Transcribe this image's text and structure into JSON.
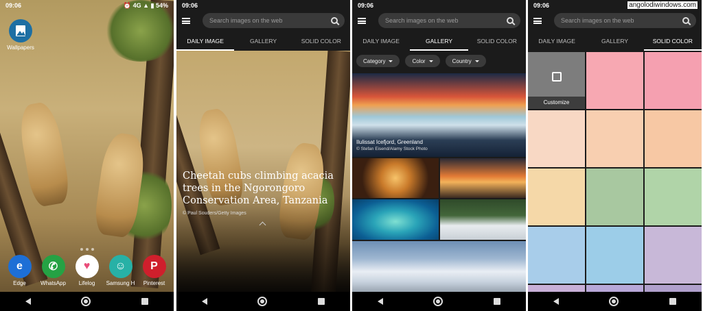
{
  "status_time": "09:06",
  "home": {
    "status_right": "⏰ 4G ▲ ▮ 54%",
    "top_app": "Wallpapers",
    "dock": [
      {
        "label": "Edge",
        "color": "#1d6fd6"
      },
      {
        "label": "WhatsApp",
        "color": "#25a244"
      },
      {
        "label": "Lifelog",
        "color": "#f2a0b6"
      },
      {
        "label": "Samsung H",
        "color": "#27b1a6"
      },
      {
        "label": "Pinterest",
        "color": "#cf1f2c"
      }
    ]
  },
  "search_placeholder": "Search images on the web",
  "tabs": [
    "DAILY IMAGE",
    "GALLERY",
    "SOLID COLOR"
  ],
  "daily": {
    "title": "Cheetah cubs climbing acacia trees in the Ngorongoro Conservation Area, Tanzania",
    "credit": "© Paul Souders/Getty Images"
  },
  "gallery": {
    "filters": [
      "Category",
      "Color",
      "Country"
    ],
    "caption_title": "Ilulissat Icefjord, Greenland",
    "caption_credit": "© Stefan Eisend/Alamy Stock Photo"
  },
  "solid": {
    "customize_label": "Customize",
    "watermark": "angolodiwindows.com",
    "colors": [
      "#7d7d7d",
      "#f7a8b2",
      "#f5a0b0",
      "#f8d8c4",
      "#f8cfb0",
      "#f7c8a4",
      "#f5d8a8",
      "#a8c8a0",
      "#b0d4a8",
      "#a8cdea",
      "#9ccde8",
      "#c8b8d8"
    ]
  }
}
